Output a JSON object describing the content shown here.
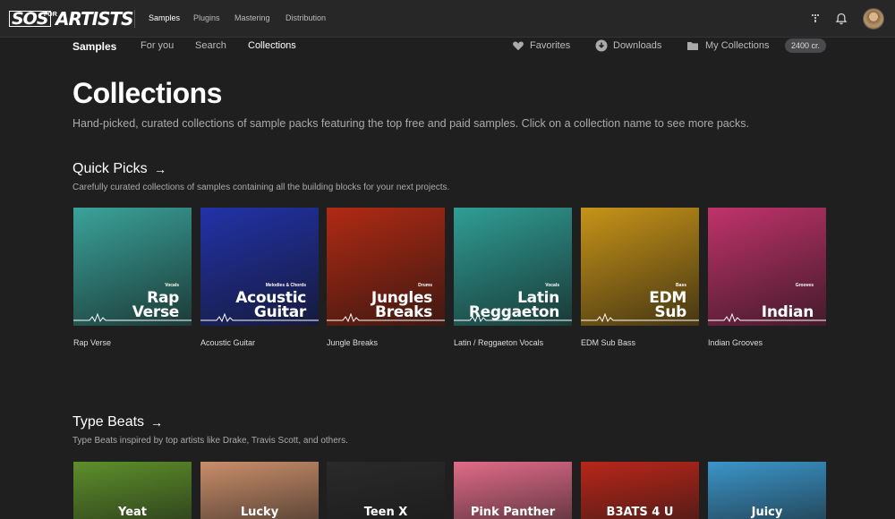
{
  "brand": {
    "sos": "SOS",
    "for": "FOR",
    "artists": "ARTISTS"
  },
  "topnav": [
    "Samples",
    "Plugins",
    "Mastering",
    "Distribution"
  ],
  "subnav": {
    "brand": "Samples",
    "tabs": [
      "For you",
      "Search",
      "Collections"
    ],
    "favorites": "Favorites",
    "downloads": "Downloads",
    "my_collections": "My Collections",
    "credits": "2400 cr."
  },
  "page": {
    "title": "Collections",
    "description": "Hand-picked, curated collections of sample packs featuring the top free and paid samples. Click on a collection name to see more packs."
  },
  "quick_picks": {
    "title": "Quick Picks",
    "arrow": "→",
    "description": "Carefully curated collections of samples containing all the building blocks for your next projects.",
    "items": [
      {
        "category": "Vocals",
        "line1": "Rap",
        "line2": "Verse",
        "caption": "Rap Verse",
        "color": "#3aa39a"
      },
      {
        "category": "Melodies & Chords",
        "line1": "Acoustic",
        "line2": "Guitar",
        "caption": "Acoustic Guitar",
        "color": "#2232a8"
      },
      {
        "category": "Drums",
        "line1": "Jungles",
        "line2": "Breaks",
        "caption": "Jungle Breaks",
        "color": "#b02a14"
      },
      {
        "category": "Vocals",
        "line1": "Latin",
        "line2": "Reggaeton",
        "caption": "Latin / Reggaeton Vocals",
        "color": "#2f9e95"
      },
      {
        "category": "Bass",
        "line1": "EDM",
        "line2": "Sub",
        "caption": "EDM Sub Bass",
        "color": "#c79418"
      },
      {
        "category": "Grooves",
        "line1": "",
        "line2": "Indian",
        "caption": "Indian Grooves",
        "color": "#c0336a"
      }
    ]
  },
  "type_beats": {
    "title": "Type Beats",
    "arrow": "→",
    "description": "Type Beats inspired by top artists like Drake, Travis Scott, and others.",
    "items": [
      {
        "name": "Yeat",
        "color": "#5d8f2a"
      },
      {
        "name": "Lucky",
        "color": "#c98e6a"
      },
      {
        "name": "Teen X",
        "color": "#2a2a2a"
      },
      {
        "name": "Pink Panther",
        "color": "#e06b88"
      },
      {
        "name": "B3ATS 4 U",
        "color": "#b8261a"
      },
      {
        "name": "Juicy",
        "color": "#3b95c9"
      }
    ]
  }
}
